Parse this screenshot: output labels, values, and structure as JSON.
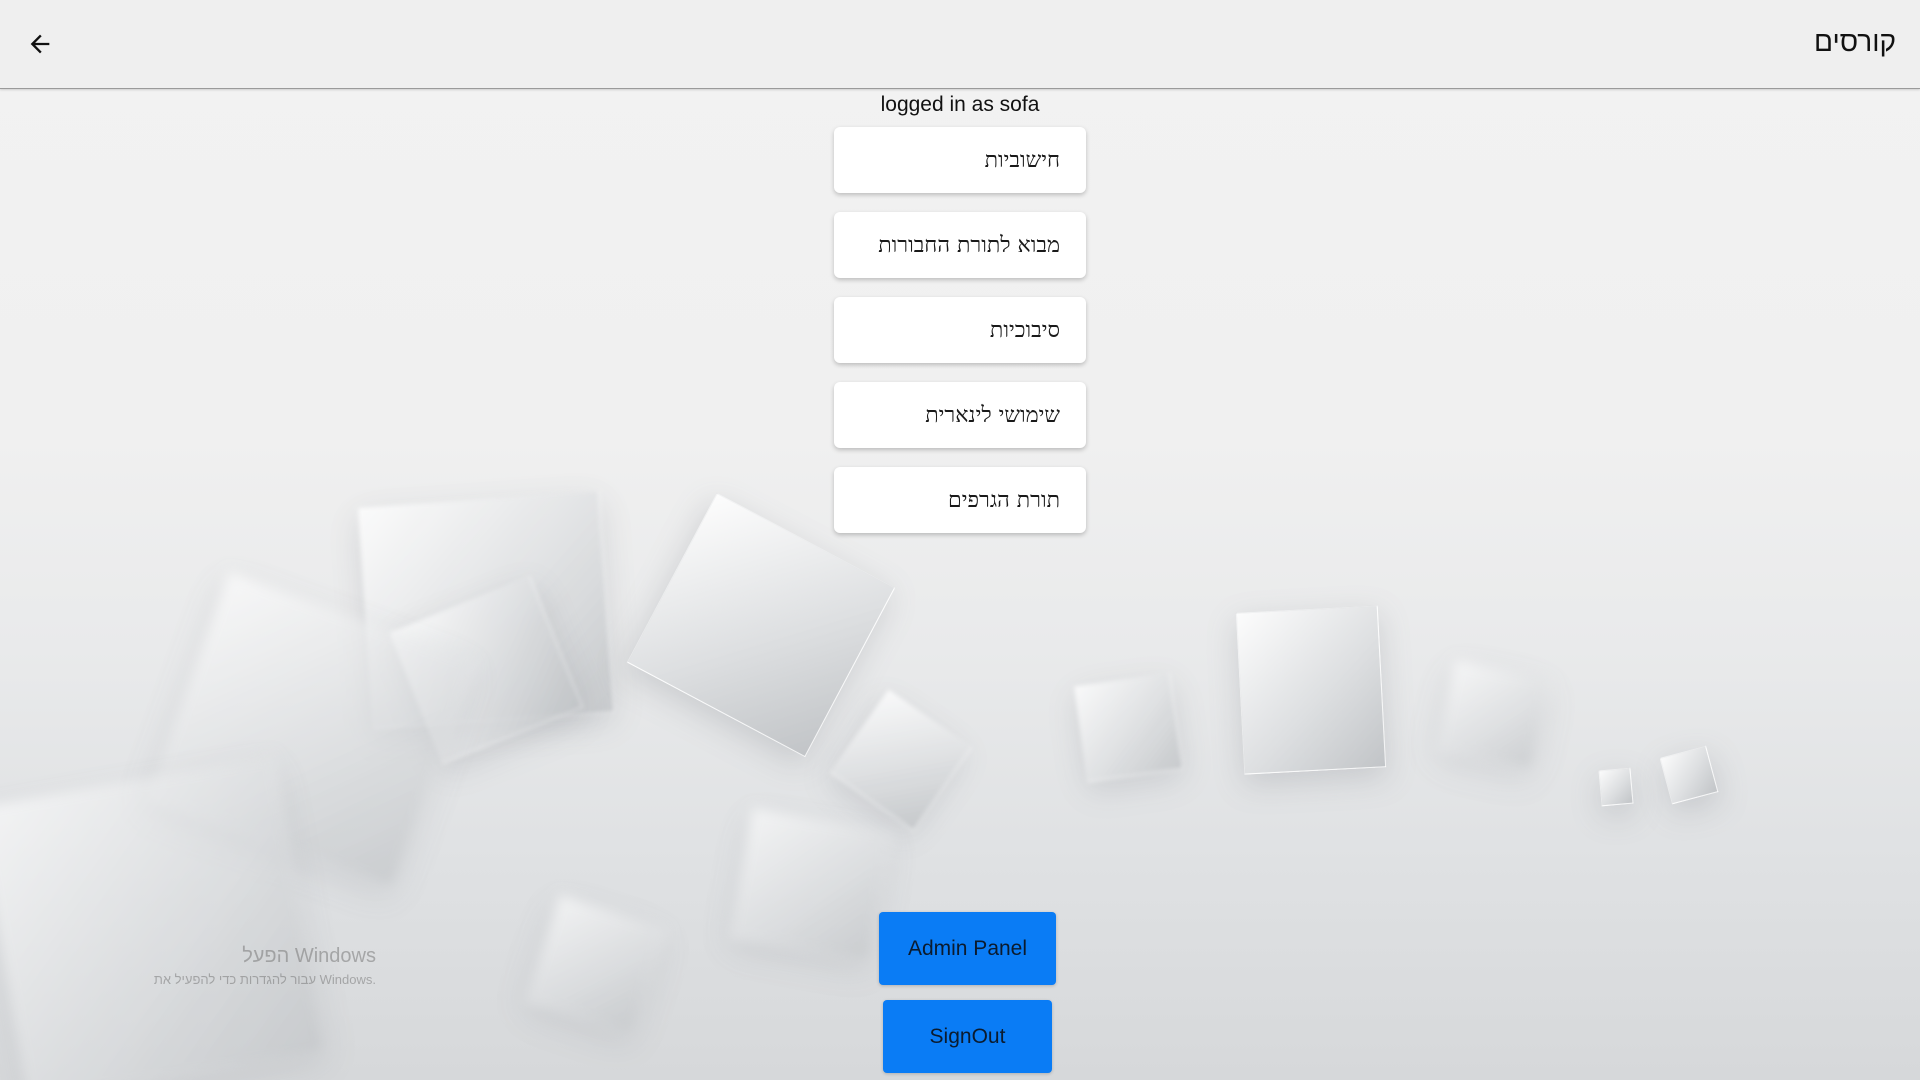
{
  "appbar": {
    "title": "קורסים",
    "back_icon": "arrow-left-icon"
  },
  "status": {
    "logged_in_text": "logged in as sofa"
  },
  "courses": [
    {
      "label": "חישוביות"
    },
    {
      "label": "מבוא לתורת החבורות"
    },
    {
      "label": "סיבוכיות"
    },
    {
      "label": "שימושי לינארית"
    },
    {
      "label": "תורת הגרפים"
    }
  ],
  "actions": {
    "admin_label": "Admin Panel",
    "signout_label": "SignOut"
  },
  "watermark": {
    "title": "הפעל Windows",
    "subtitle": "עבור להגדרות כדי להפעיל את Windows."
  },
  "colors": {
    "primary": "#0a7cf5",
    "appbar_bg": "#efefef",
    "card_bg": "#ffffff"
  }
}
